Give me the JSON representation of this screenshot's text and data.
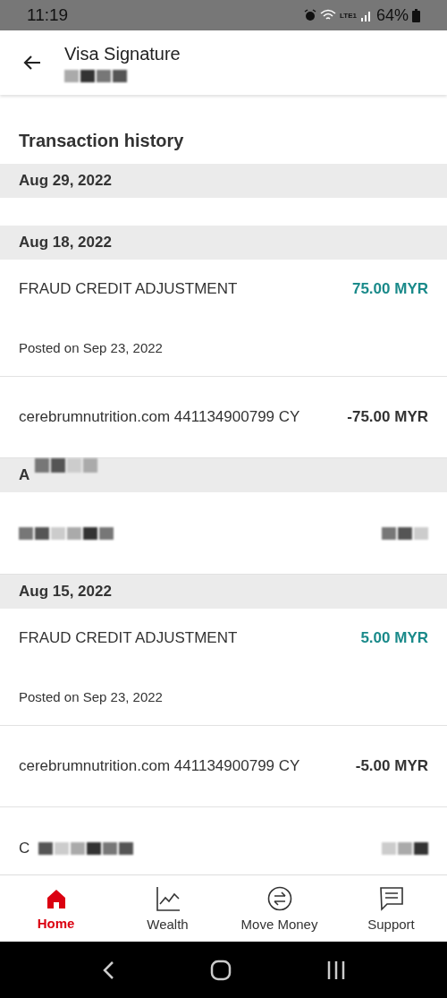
{
  "status_bar": {
    "time": "11:19",
    "battery": "64%",
    "network": "LTE1"
  },
  "header": {
    "title": "Visa Signature"
  },
  "section_title": "Transaction history",
  "groups": [
    {
      "date": "Aug 29, 2022",
      "kind": "date"
    },
    {
      "date": "Aug 18, 2022",
      "kind": "date",
      "transactions": [
        {
          "description": "FRAUD CREDIT ADJUSTMENT",
          "amount": "75.00 MYR",
          "kind": "credit",
          "posted": "Posted on Sep 23, 2022"
        },
        {
          "description": "cerebrumnutrition.com 441134900799 CY",
          "amount": "-75.00 MYR",
          "kind": "debit"
        }
      ]
    },
    {
      "date": "A",
      "kind": "masked",
      "transactions": [
        {
          "kind": "redacted"
        }
      ]
    },
    {
      "date": "Aug 15, 2022",
      "kind": "date",
      "transactions": [
        {
          "description": "FRAUD CREDIT ADJUSTMENT",
          "amount": "5.00 MYR",
          "kind": "credit",
          "posted": "Posted on Sep 23, 2022"
        },
        {
          "description": "cerebrumnutrition.com 441134900799 CY",
          "amount": "-5.00 MYR",
          "kind": "debit"
        },
        {
          "description": "C",
          "kind": "redacted"
        }
      ]
    }
  ],
  "nav": [
    {
      "label": "Home",
      "kind": "home",
      "selected": true
    },
    {
      "label": "Wealth",
      "kind": "chart",
      "selected": false
    },
    {
      "label": "Move Money",
      "kind": "transfer",
      "selected": false
    },
    {
      "label": "Support",
      "kind": "chat",
      "selected": false
    }
  ]
}
